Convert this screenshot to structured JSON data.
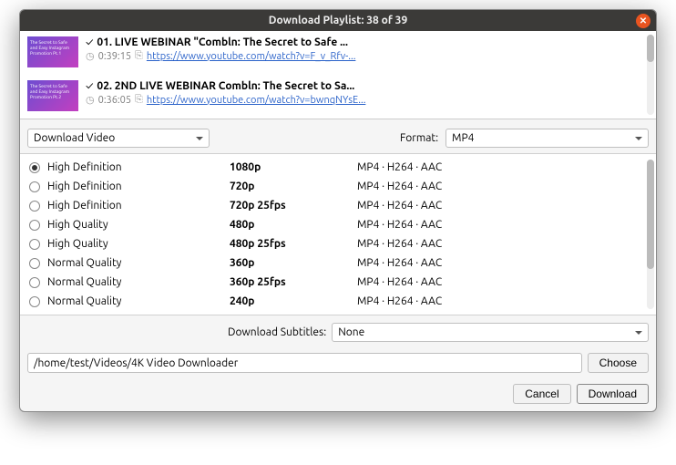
{
  "title": "Download Playlist: 38 of 39",
  "items": [
    {
      "title": "01. LIVE WEBINAR \"Combln: The Secret to Safe ...",
      "duration": "0:39:15",
      "url": "https://www.youtube.com/watch?v=F_v_Rfv-...",
      "thumb_text": "The Secret to Safe and Easy Instagram Promotion Pt.1"
    },
    {
      "title": "02. 2ND LIVE WEBINAR Combln: The Secret to Sa...",
      "duration": "0:36:05",
      "url": "https://www.youtube.com/watch?v=bwnqNYsE...",
      "thumb_text": "The Secret to Safe and Easy Instagram Promotion Pt.2"
    }
  ],
  "action_dropdown": "Download Video",
  "format_label": "Format:",
  "format_value": "MP4",
  "qualities": [
    {
      "selected": true,
      "quality": "High Definition",
      "res": "1080p",
      "codec": "MP4 · H264 · AAC"
    },
    {
      "selected": false,
      "quality": "High Definition",
      "res": "720p",
      "codec": "MP4 · H264 · AAC"
    },
    {
      "selected": false,
      "quality": "High Definition",
      "res": "720p 25fps",
      "codec": "MP4 · H264 · AAC"
    },
    {
      "selected": false,
      "quality": "High Quality",
      "res": "480p",
      "codec": "MP4 · H264 · AAC"
    },
    {
      "selected": false,
      "quality": "High Quality",
      "res": "480p 25fps",
      "codec": "MP4 · H264 · AAC"
    },
    {
      "selected": false,
      "quality": "Normal Quality",
      "res": "360p",
      "codec": "MP4 · H264 · AAC"
    },
    {
      "selected": false,
      "quality": "Normal Quality",
      "res": "360p 25fps",
      "codec": "MP4 · H264 · AAC"
    },
    {
      "selected": false,
      "quality": "Normal Quality",
      "res": "240p",
      "codec": "MP4 · H264 · AAC"
    }
  ],
  "subtitles_label": "Download Subtitles:",
  "subtitles_value": "None",
  "path": "/home/test/Videos/4K Video Downloader",
  "choose_label": "Choose",
  "cancel_label": "Cancel",
  "download_label": "Download"
}
